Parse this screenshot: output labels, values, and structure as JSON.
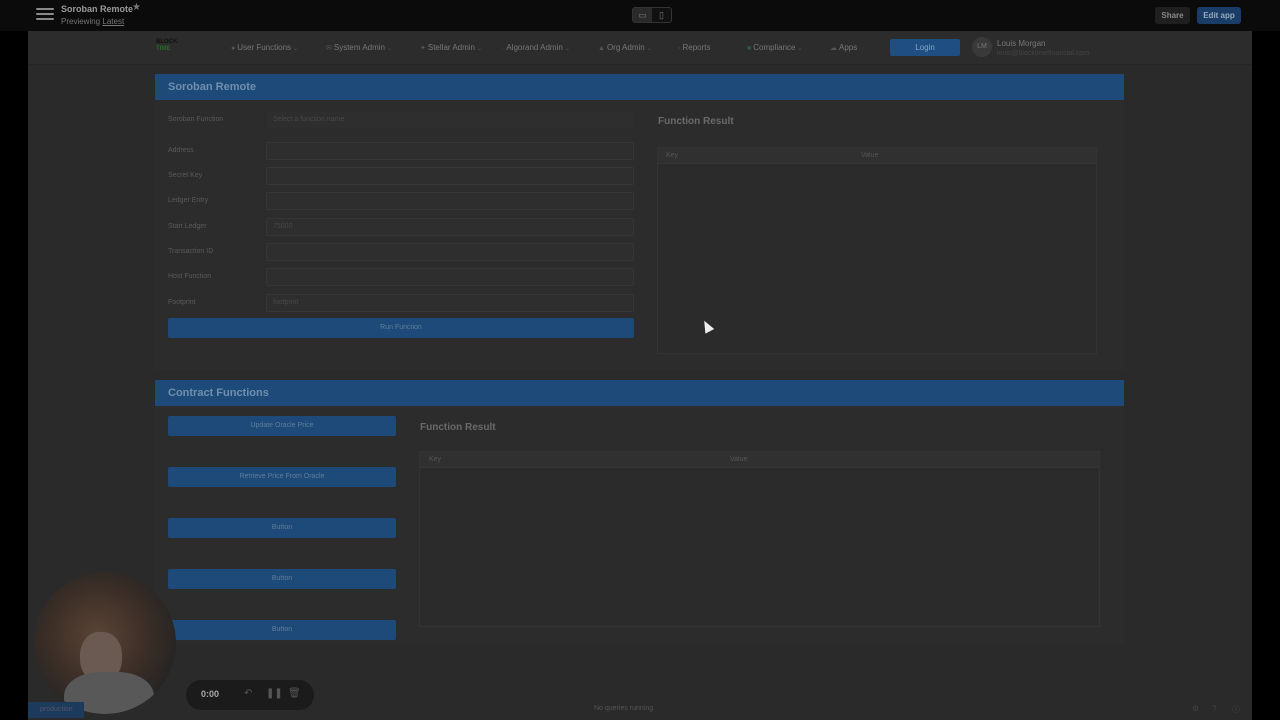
{
  "topbar": {
    "title": "Soroban Remote",
    "previewing_prefix": "Previewing",
    "previewing_link": "Latest",
    "share_label": "Share",
    "edit_label": "Edit app"
  },
  "nav": {
    "logo_line1": "BLOCK",
    "logo_line2": "TIME",
    "items": [
      {
        "label": "User Functions",
        "icon": "user-icon"
      },
      {
        "label": "System Admin",
        "icon": "envelope-icon"
      },
      {
        "label": "Stellar Admin",
        "icon": "star-icon"
      },
      {
        "label": "Algorand Admin",
        "icon": "dot-icon"
      },
      {
        "label": "Org Admin",
        "icon": "building-icon"
      },
      {
        "label": "Reports",
        "icon": "report-icon"
      },
      {
        "label": "Compliance",
        "icon": "check-icon"
      },
      {
        "label": "Apps",
        "icon": "cloud-icon"
      }
    ],
    "login_label": "Login",
    "user_initials": "LM",
    "user_name": "Louis Morgan",
    "user_email": "louis@blocktimefinancial.com"
  },
  "soroban": {
    "header": "Soroban Remote",
    "fields": [
      {
        "label": "Soroban Function",
        "value": "Select a function name"
      },
      {
        "label": "Address",
        "value": ""
      },
      {
        "label": "Secret Key",
        "value": ""
      },
      {
        "label": "Ledger Entry",
        "value": ""
      },
      {
        "label": "Start Ledger",
        "value": "75000"
      },
      {
        "label": "Transaction ID",
        "value": ""
      },
      {
        "label": "Host Function",
        "value": ""
      },
      {
        "label": "Footprint",
        "value": "footprint"
      }
    ],
    "run_label": "Run Function",
    "result_title": "Function Result",
    "col_key": "Key",
    "col_value": "Value"
  },
  "contract": {
    "header": "Contract Functions",
    "buttons": [
      "Update Oracle Price",
      "Retrieve Price From Oracle",
      "Button",
      "Button",
      "Button"
    ],
    "result_title": "Function Result",
    "col_key": "Key",
    "col_value": "Value"
  },
  "recorder": {
    "time": "0:00"
  },
  "statusbar": {
    "env": "production",
    "queries": "No queries running"
  }
}
